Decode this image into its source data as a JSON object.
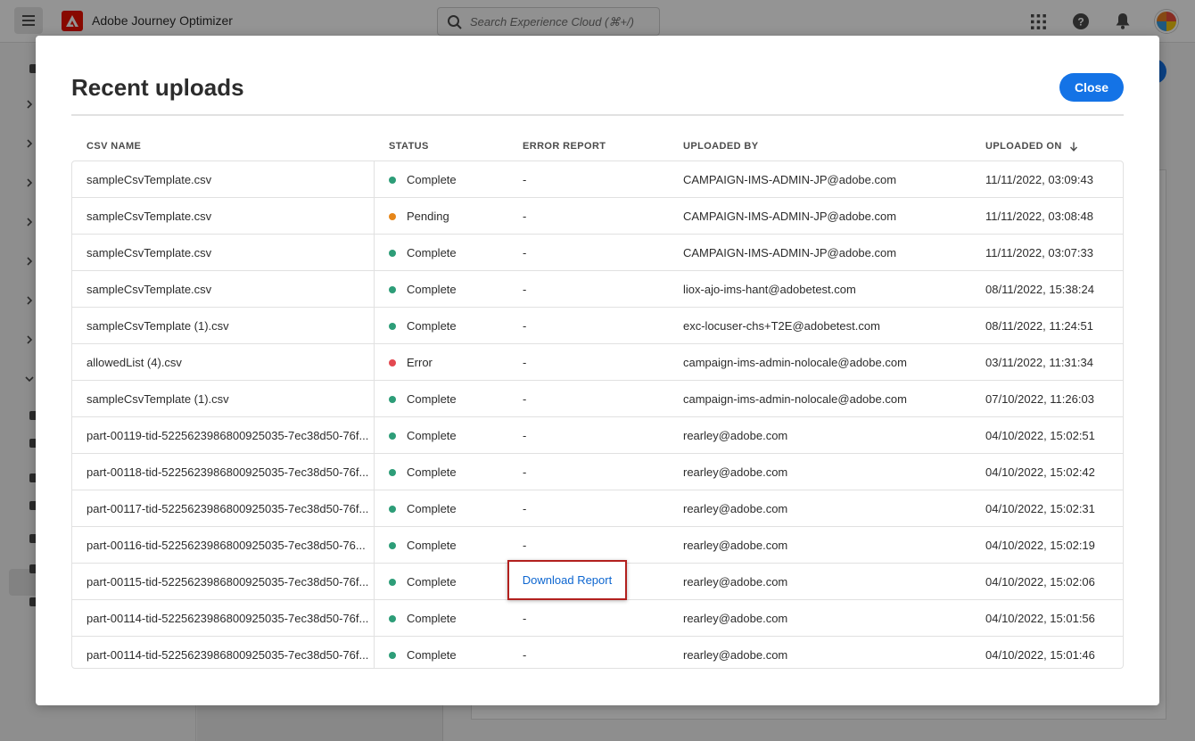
{
  "topbar": {
    "app_name": "Adobe Journey Optimizer",
    "search_placeholder": "Search Experience Cloud (⌘+/)"
  },
  "modal": {
    "title": "Recent uploads",
    "close_label": "Close",
    "columns": {
      "csv_name": "CSV NAME",
      "status": "STATUS",
      "error_report": "ERROR REPORT",
      "uploaded_by": "UPLOADED BY",
      "uploaded_on": "UPLOADED ON"
    },
    "rows": [
      {
        "name": "sampleCsvTemplate.csv",
        "status": "Complete",
        "error": "-",
        "user": "CAMPAIGN-IMS-ADMIN-JP@adobe.com",
        "date": "11/11/2022, 03:09:43"
      },
      {
        "name": "sampleCsvTemplate.csv",
        "status": "Pending",
        "error": "-",
        "user": "CAMPAIGN-IMS-ADMIN-JP@adobe.com",
        "date": "11/11/2022, 03:08:48"
      },
      {
        "name": "sampleCsvTemplate.csv",
        "status": "Complete",
        "error": "-",
        "user": "CAMPAIGN-IMS-ADMIN-JP@adobe.com",
        "date": "11/11/2022, 03:07:33"
      },
      {
        "name": "sampleCsvTemplate.csv",
        "status": "Complete",
        "error": "-",
        "user": "liox-ajo-ims-hant@adobetest.com",
        "date": "08/11/2022, 15:38:24"
      },
      {
        "name": "sampleCsvTemplate (1).csv",
        "status": "Complete",
        "error": "-",
        "user": "exc-locuser-chs+T2E@adobetest.com",
        "date": "08/11/2022, 11:24:51"
      },
      {
        "name": "allowedList (4).csv",
        "status": "Error",
        "error": "-",
        "user": "campaign-ims-admin-nolocale@adobe.com",
        "date": "03/11/2022, 11:31:34"
      },
      {
        "name": "sampleCsvTemplate (1).csv",
        "status": "Complete",
        "error": "-",
        "user": "campaign-ims-admin-nolocale@adobe.com",
        "date": "07/10/2022, 11:26:03"
      },
      {
        "name": "part-00119-tid-5225623986800925035-7ec38d50-76f...",
        "status": "Complete",
        "error": "-",
        "user": "rearley@adobe.com",
        "date": "04/10/2022, 15:02:51"
      },
      {
        "name": "part-00118-tid-5225623986800925035-7ec38d50-76f...",
        "status": "Complete",
        "error": "-",
        "user": "rearley@adobe.com",
        "date": "04/10/2022, 15:02:42"
      },
      {
        "name": "part-00117-tid-5225623986800925035-7ec38d50-76f...",
        "status": "Complete",
        "error": "-",
        "user": "rearley@adobe.com",
        "date": "04/10/2022, 15:02:31"
      },
      {
        "name": "part-00116-tid-5225623986800925035-7ec38d50-76...",
        "status": "Complete",
        "error": "-",
        "user": "rearley@adobe.com",
        "date": "04/10/2022, 15:02:19"
      },
      {
        "name": "part-00115-tid-5225623986800925035-7ec38d50-76f...",
        "status": "Complete",
        "error": "Download Report",
        "user": "rearley@adobe.com",
        "date": "04/10/2022, 15:02:06"
      },
      {
        "name": "part-00114-tid-5225623986800925035-7ec38d50-76f...",
        "status": "Complete",
        "error": "-",
        "user": "rearley@adobe.com",
        "date": "04/10/2022, 15:01:56"
      },
      {
        "name": "part-00114-tid-5225623986800925035-7ec38d50-76f...",
        "status": "Complete",
        "error": "-",
        "user": "rearley@adobe.com",
        "date": "04/10/2022, 15:01:46"
      }
    ]
  },
  "colors": {
    "accent": "#1473e6",
    "status_complete": "#2d9d78",
    "status_pending": "#e68619",
    "status_error": "#e34850",
    "highlight_border": "#b2201e",
    "link": "#0d66d0"
  },
  "icons": {
    "menu": "hamburger-icon",
    "logo": "adobe-logo-icon",
    "search": "search-icon",
    "apps": "app-grid-icon",
    "help": "help-icon",
    "notifications": "bell-icon",
    "sort": "arrow-down-icon"
  }
}
